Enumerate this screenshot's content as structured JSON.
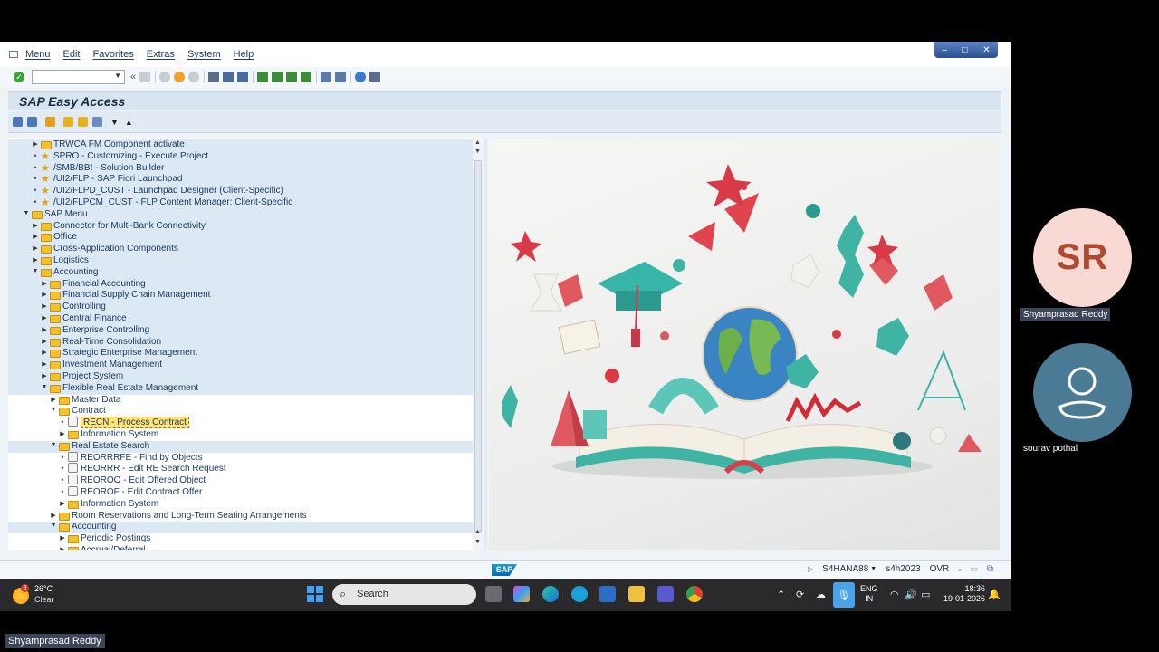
{
  "menubar": {
    "items": [
      "Menu",
      "Edit",
      "Favorites",
      "Extras",
      "System",
      "Help"
    ]
  },
  "window_controls": [
    "–",
    "□",
    "✕"
  ],
  "titlebar": {
    "title": "SAP Easy Access"
  },
  "tree": {
    "rows": [
      {
        "label": "TRWCA FM Component activate",
        "indent": 2,
        "kind": "folder",
        "expander": "right"
      },
      {
        "label": "SPRO - Customizing - Execute Project",
        "indent": 2,
        "kind": "star",
        "expander": "dot"
      },
      {
        "label": "/SMB/BBI - Solution Builder",
        "indent": 2,
        "kind": "star",
        "expander": "dot"
      },
      {
        "label": "/UI2/FLP - SAP Fiori Launchpad",
        "indent": 2,
        "kind": "star",
        "expander": "dot"
      },
      {
        "label": "/UI2/FLPD_CUST - Launchpad Designer (Client-Specific)",
        "indent": 2,
        "kind": "star",
        "expander": "dot"
      },
      {
        "label": "/UI2/FLPCM_CUST - FLP Content Manager: Client-Specific",
        "indent": 2,
        "kind": "star",
        "expander": "dot"
      },
      {
        "label": "SAP Menu",
        "indent": 1,
        "kind": "folder-open",
        "expander": "down"
      },
      {
        "label": "Connector for Multi-Bank Connectivity",
        "indent": 2,
        "kind": "folder",
        "expander": "right"
      },
      {
        "label": "Office",
        "indent": 2,
        "kind": "folder",
        "expander": "right"
      },
      {
        "label": "Cross-Application Components",
        "indent": 2,
        "kind": "folder",
        "expander": "right"
      },
      {
        "label": "Logistics",
        "indent": 2,
        "kind": "folder",
        "expander": "right"
      },
      {
        "label": "Accounting",
        "indent": 2,
        "kind": "folder-open",
        "expander": "down"
      },
      {
        "label": "Financial Accounting",
        "indent": 3,
        "kind": "folder",
        "expander": "right"
      },
      {
        "label": "Financial Supply Chain Management",
        "indent": 3,
        "kind": "folder",
        "expander": "right"
      },
      {
        "label": "Controlling",
        "indent": 3,
        "kind": "folder",
        "expander": "right"
      },
      {
        "label": "Central Finance",
        "indent": 3,
        "kind": "folder",
        "expander": "right"
      },
      {
        "label": "Enterprise Controlling",
        "indent": 3,
        "kind": "folder",
        "expander": "right"
      },
      {
        "label": "Real-Time Consolidation",
        "indent": 3,
        "kind": "folder",
        "expander": "right"
      },
      {
        "label": "Strategic Enterprise Management",
        "indent": 3,
        "kind": "folder",
        "expander": "right"
      },
      {
        "label": "Investment Management",
        "indent": 3,
        "kind": "folder",
        "expander": "right"
      },
      {
        "label": "Project System",
        "indent": 3,
        "kind": "folder",
        "expander": "right"
      },
      {
        "label": "Flexible Real Estate Management",
        "indent": 3,
        "kind": "folder-open",
        "expander": "down"
      },
      {
        "label": "Master Data",
        "indent": 4,
        "kind": "folder",
        "expander": "right"
      },
      {
        "label": "Contract",
        "indent": 4,
        "kind": "folder-open",
        "expander": "down"
      },
      {
        "label": "RECN - Process Contract",
        "indent": 5,
        "kind": "tx",
        "expander": "dot",
        "highlight": true
      },
      {
        "label": "Information System",
        "indent": 5,
        "kind": "folder",
        "expander": "right"
      },
      {
        "label": "Real Estate Search",
        "indent": 4,
        "kind": "folder-open",
        "expander": "down"
      },
      {
        "label": "REORRRFE - Find by Objects",
        "indent": 5,
        "kind": "tx",
        "expander": "dot"
      },
      {
        "label": "REORRR - Edit RE Search Request",
        "indent": 5,
        "kind": "tx",
        "expander": "dot"
      },
      {
        "label": "REOROO - Edit Offered Object",
        "indent": 5,
        "kind": "tx",
        "expander": "dot"
      },
      {
        "label": "REOROF - Edit Contract Offer",
        "indent": 5,
        "kind": "tx",
        "expander": "dot"
      },
      {
        "label": "Information System",
        "indent": 5,
        "kind": "folder",
        "expander": "right"
      },
      {
        "label": "Room Reservations and Long-Term Seating Arrangements",
        "indent": 4,
        "kind": "folder",
        "expander": "right"
      },
      {
        "label": "Accounting",
        "indent": 4,
        "kind": "folder-open",
        "expander": "down"
      },
      {
        "label": "Periodic Postings",
        "indent": 5,
        "kind": "folder",
        "expander": "right"
      },
      {
        "label": "Accrual/Deferral",
        "indent": 5,
        "kind": "folder",
        "expander": "right"
      }
    ]
  },
  "statusbar": {
    "logo": "SAP",
    "system": "S4HANA88",
    "client": "s4h2023",
    "mode": "OVR"
  },
  "taskbar": {
    "weather_badge": "9",
    "temperature": "26°C",
    "condition": "Clear",
    "search_placeholder": "Search",
    "lang_1": "ENG",
    "lang_2": "IN",
    "time": "18:36",
    "date": "19-01-2026"
  },
  "participants": {
    "presenter_initials": "SR",
    "presenter_name": "Shyamprasad Reddy",
    "second_name": "sourav pothal",
    "bottom_label": "Shyamprasad Reddy"
  },
  "colors": {
    "sap_blue": "#0a64b4",
    "folder": "#f3c12b",
    "avatar_pink": "#f8d9d4",
    "avatar_teal": "#4b7b94"
  }
}
